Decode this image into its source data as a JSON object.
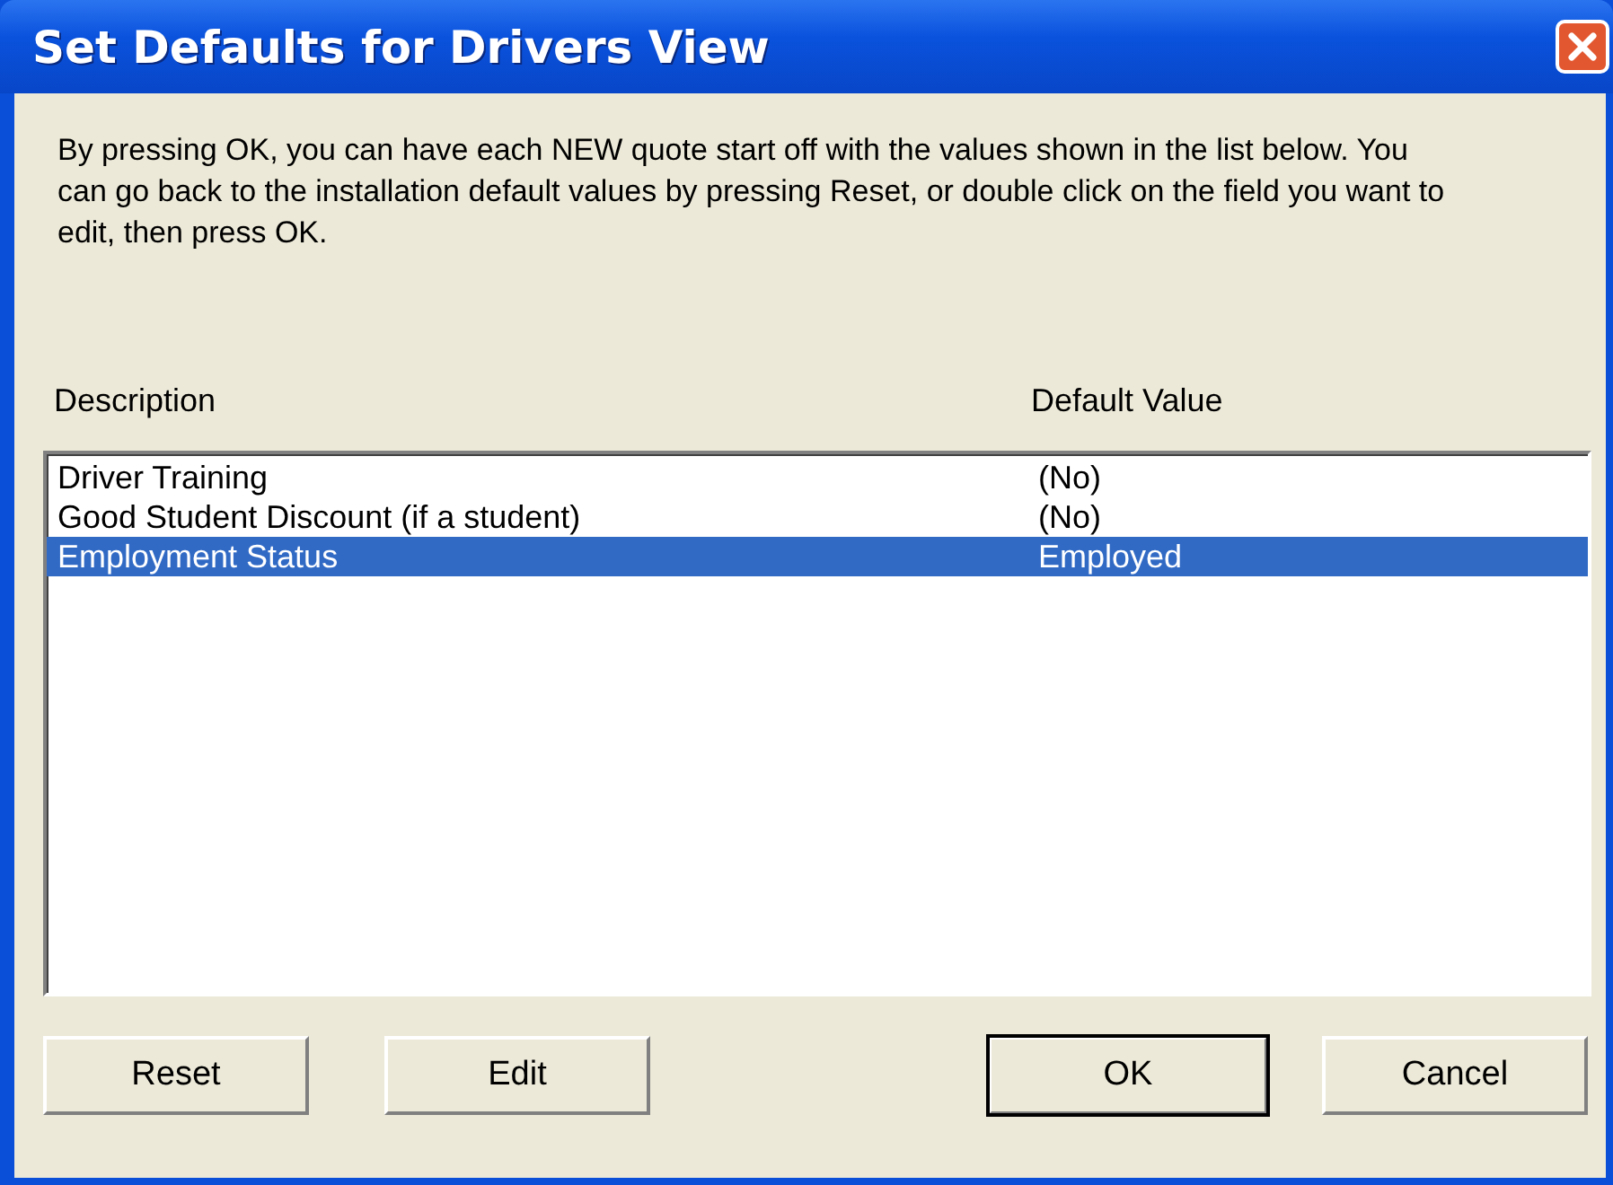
{
  "window": {
    "title": "Set Defaults for Drivers View"
  },
  "instructions": "By pressing OK, you can have each NEW quote start off with the values shown in the list below.  You can go back to the installation default values by pressing Reset, or double click on the field you want to edit, then press OK.",
  "list": {
    "columns": [
      "Description",
      "Default Value"
    ],
    "rows": [
      {
        "description": "Driver Training",
        "value": "(No)",
        "selected": false
      },
      {
        "description": "Good Student Discount (if a student)",
        "value": "(No)",
        "selected": false
      },
      {
        "description": "Employment Status",
        "value": "Employed",
        "selected": true
      }
    ]
  },
  "buttons": [
    {
      "label": "Reset",
      "default": false
    },
    {
      "label": "Edit",
      "default": false
    },
    {
      "label": "OK",
      "default": true
    },
    {
      "label": "Cancel",
      "default": false
    }
  ]
}
